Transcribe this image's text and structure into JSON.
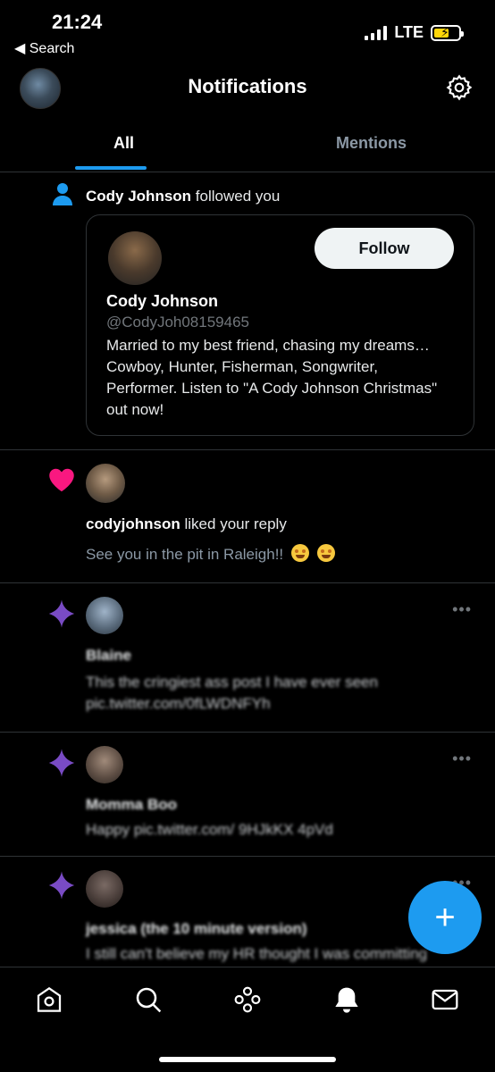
{
  "status_bar": {
    "time": "21:24",
    "back_label": "◀ Search",
    "network": "LTE"
  },
  "header": {
    "title": "Notifications",
    "settings_icon": "gear-icon"
  },
  "tabs": [
    {
      "label": "All",
      "active": true
    },
    {
      "label": "Mentions",
      "active": false
    }
  ],
  "follow_notification": {
    "name": "Cody Johnson",
    "action": " followed you",
    "follow_button": "Follow",
    "card_name": "Cody Johnson",
    "card_handle": "@CodyJoh08159465",
    "card_bio": "Married to my best friend, chasing my dreams… Cowboy, Hunter, Fisherman, Songwriter, Performer. Listen to \"A Cody Johnson Christmas\" out now!"
  },
  "like_notification": {
    "name": "codyjohnson",
    "action": " liked your reply",
    "reply_text": "See you in the pit in Raleigh!!"
  },
  "recommended": [
    {
      "name": "Blaine",
      "text": "This the cringiest ass post I have ever seen",
      "text2": "pic.twitter.com/0fLWDNFYh",
      "more": "•••"
    },
    {
      "name": "Momma Boo",
      "text": "Happy pic.twitter.com/ 9HJkKX 4pVd",
      "more": "•••"
    },
    {
      "name": "jessica (the 10 minute version)",
      "text": "I still can't believe my HR thought I was committing",
      "more": "•••"
    }
  ],
  "fab_label": "+",
  "bottom_nav": [
    "home-icon",
    "search-icon",
    "spaces-icon",
    "notifications-icon",
    "messages-icon"
  ],
  "colors": {
    "accent": "#1d9bf0",
    "like": "#f91880",
    "sparkle": "#794bc4",
    "background": "#000000"
  }
}
